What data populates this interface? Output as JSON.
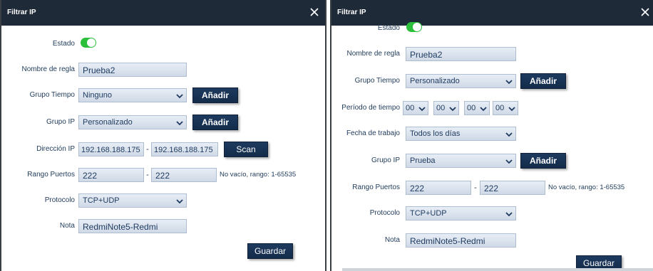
{
  "left": {
    "title": "Filtrar IP",
    "estado_label": "Estado",
    "nombre_label": "Nombre de regla",
    "nombre_value": "Prueba2",
    "grupo_tiempo_label": "Grupo Tiempo",
    "grupo_tiempo_value": "Ninguno",
    "grupo_ip_label": "Grupo IP",
    "grupo_ip_value": "Personalizado",
    "direccion_label": "Dirección IP",
    "ip_start": "192.168.188.175",
    "ip_dash": "-",
    "ip_end": "192.168.188.175",
    "scan_label": "Scan",
    "rango_label": "Rango Puertos",
    "port_start": "222",
    "port_dash": "-",
    "port_end": "222",
    "port_hint": "No vacío, rango: 1-65535",
    "protocolo_label": "Protocolo",
    "protocolo_value": "TCP+UDP",
    "nota_label": "Nota",
    "nota_value": "RedmiNote5-Redmi",
    "anadir_label": "Añadir",
    "guardar_label": "Guardar"
  },
  "right": {
    "title": "Filtrar IP",
    "estado_label": "Estado",
    "nombre_label": "Nombre de regla",
    "nombre_value": "Prueba2",
    "grupo_tiempo_label": "Grupo Tiempo",
    "grupo_tiempo_value": "Personalizado",
    "periodo_label": "Período de tiempo",
    "periodo_values": [
      "00",
      "00",
      "00",
      "00"
    ],
    "fecha_label": "Fecha de trabajo",
    "fecha_value": "Todos los días",
    "grupo_ip_label": "Grupo IP",
    "grupo_ip_value": "Prueba",
    "rango_label": "Rango Puertos",
    "port_start": "222",
    "port_dash": "-",
    "port_end": "222",
    "port_hint": "No vacío, rango: 1-65535",
    "protocolo_label": "Protocolo",
    "protocolo_value": "TCP+UDP",
    "nota_label": "Nota",
    "nota_value": "RedmiNote5-Redmi",
    "anadir_label": "Añadir",
    "guardar_label": "Guardar"
  },
  "colors": {
    "titlebar": "#1f2a38",
    "toggle_on": "#2bbf3c",
    "button": "#1d3a5f",
    "label_text": "#1f3a5a"
  },
  "icons": {
    "close": "close-icon",
    "dropdown": "chevron-down-icon"
  }
}
